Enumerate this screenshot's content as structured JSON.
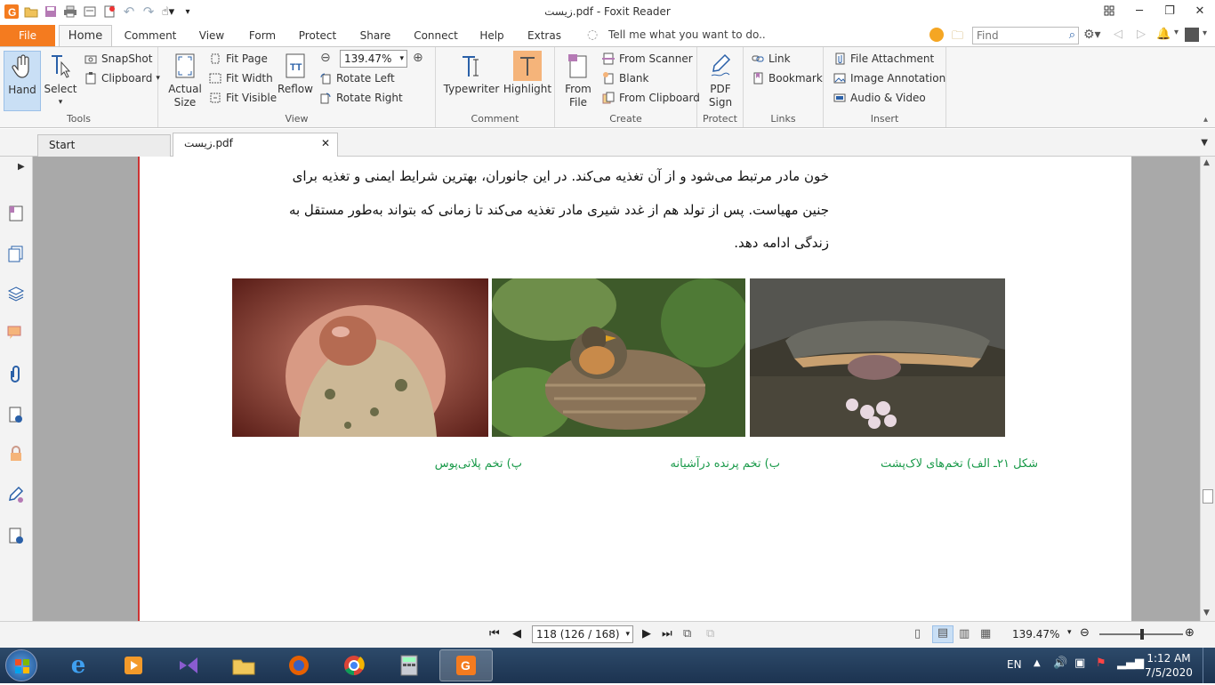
{
  "window": {
    "title": "زیست.pdf - Foxit Reader"
  },
  "ribbon_tabs": [
    "File",
    "Home",
    "Comment",
    "View",
    "Form",
    "Protect",
    "Share",
    "Connect",
    "Help",
    "Extras"
  ],
  "tell_me": "Tell me what you want to do..",
  "find_placeholder": "Find",
  "tools": {
    "hand": "Hand",
    "select": "Select",
    "snapshot": "SnapShot",
    "clipboard": "Clipboard",
    "label": "Tools"
  },
  "view": {
    "actual_size_1": "Actual",
    "actual_size_2": "Size",
    "fit_page": "Fit Page",
    "fit_width": "Fit Width",
    "fit_visible": "Fit Visible",
    "reflow": "Reflow",
    "zoom": "139.47%",
    "rotate_left": "Rotate Left",
    "rotate_right": "Rotate Right",
    "label": "View"
  },
  "comment": {
    "typewriter": "Typewriter",
    "highlight": "Highlight",
    "label": "Comment"
  },
  "create": {
    "from_file_1": "From",
    "from_file_2": "File",
    "from_scanner": "From Scanner",
    "blank": "Blank",
    "from_clipboard": "From Clipboard",
    "label": "Create"
  },
  "protect": {
    "pdf_sign_1": "PDF",
    "pdf_sign_2": "Sign",
    "label": "Protect"
  },
  "links": {
    "link": "Link",
    "bookmark": "Bookmark",
    "label": "Links"
  },
  "insert": {
    "file_attachment": "File Attachment",
    "image_annotation": "Image Annotation",
    "audio_video": "Audio & Video",
    "label": "Insert"
  },
  "doc_tabs": {
    "start": "Start",
    "file": "زیست.pdf"
  },
  "page_text": {
    "line1": "خون مادر مرتبط می‌شود و از آن تغذیه می‌کند. در این جانوران، بهترین شرایط ایمنی و تغذیه برای",
    "line2": "جنین مهیاست. پس از تولد هم از غدد شیری مادر تغذیه می‌کند تا زمانی که بتواند به‌طور مستقل به",
    "line3": "زندگی ادامه دهد.",
    "caption_a": "شکل ۲۱ـ الف) تخم‌های لاک‌پشت",
    "caption_b": "ب) تخم پرنده درآشیانه",
    "caption_c": "پ) تخم پلاتی‌پوس"
  },
  "status": {
    "page": "118 (126 / 168)",
    "zoom": "139.47%"
  },
  "tray": {
    "lang": "EN",
    "time": "1:12 AM",
    "date": "7/5/2020"
  },
  "colors": {
    "accent": "#f47b1f",
    "caption": "#1a9a4a"
  }
}
